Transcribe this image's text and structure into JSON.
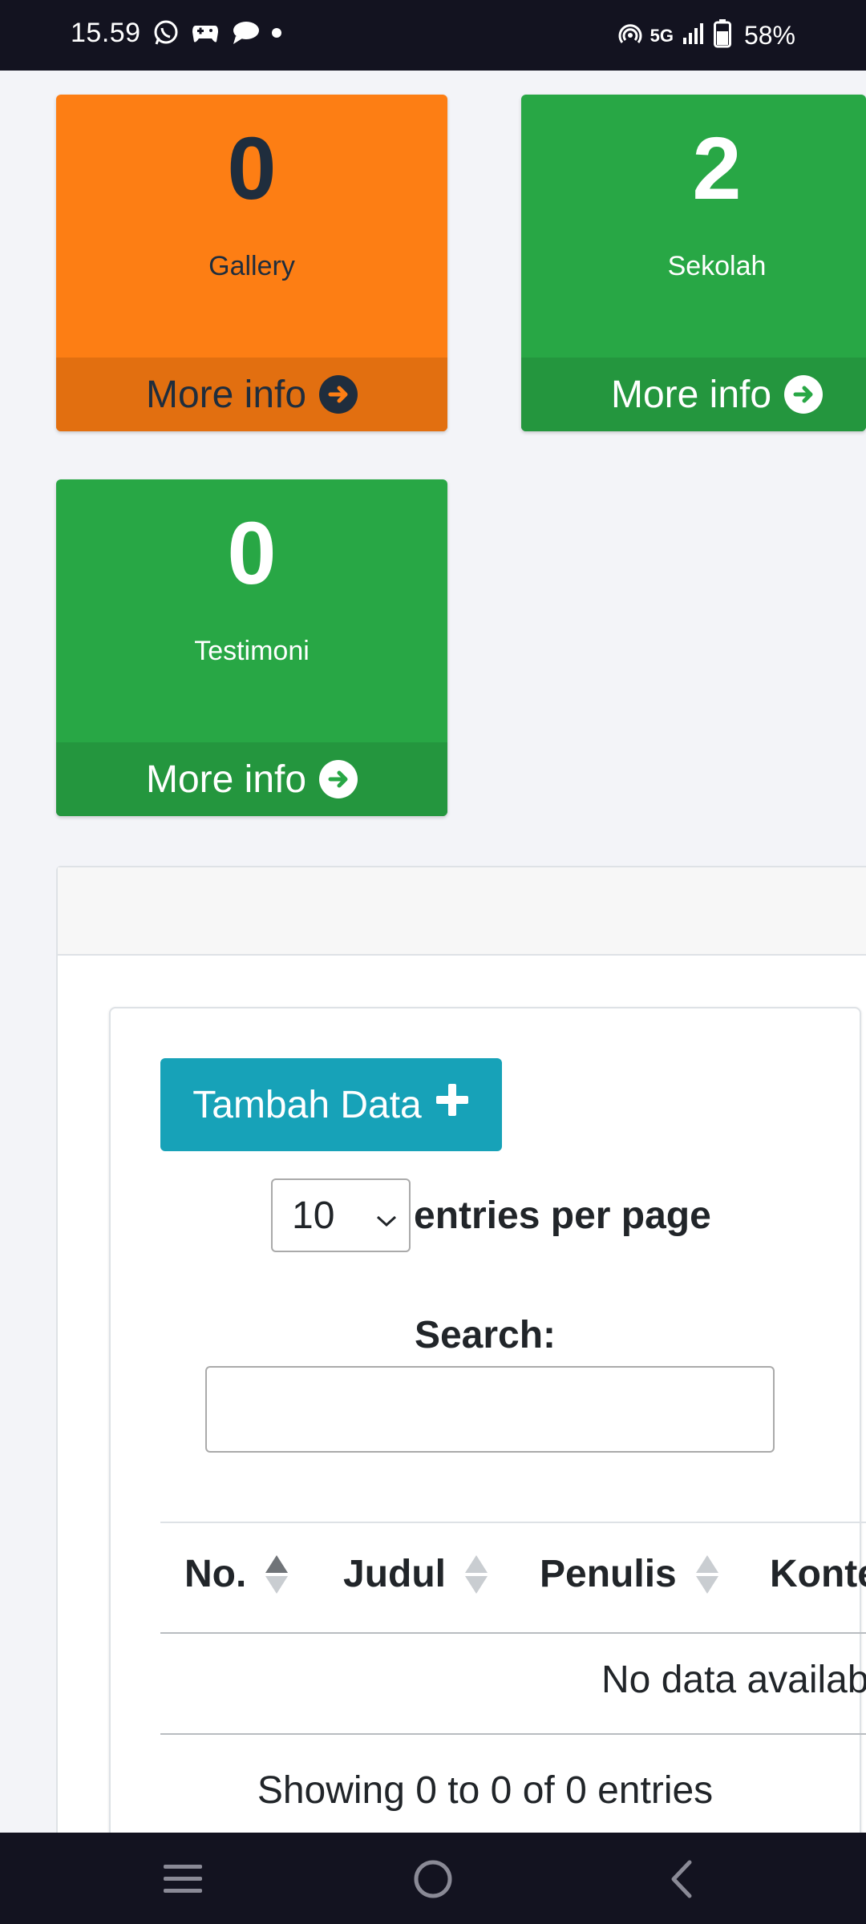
{
  "status_bar": {
    "time": "15.59",
    "network": "5G",
    "battery": "58%",
    "icons": [
      "whatsapp-icon",
      "gamepad-icon",
      "message-icon",
      "dot-icon",
      "hotspot-icon",
      "signal-icon",
      "battery-icon"
    ]
  },
  "boxes": [
    {
      "count": "0",
      "label": "Gallery",
      "more": "More info",
      "color": "#fd7e14"
    },
    {
      "count": "2",
      "label": "Sekolah",
      "more": "More info",
      "color": "#28a745"
    },
    {
      "count": "0",
      "label": "Testimoni",
      "more": "More info",
      "color": "#28a745"
    }
  ],
  "table": {
    "add_button": "Tambah Data",
    "page_size": "10",
    "entries_label": "entries per page",
    "search_label": "Search:",
    "search_value": "",
    "columns": [
      "No.",
      "Judul",
      "Penulis",
      "Konte"
    ],
    "empty_message": "No data available",
    "info": "Showing 0 to 0 of 0 entries"
  },
  "nav": {
    "icons": [
      "menu-icon",
      "home-icon",
      "back-icon"
    ]
  },
  "colors": {
    "info": "#17a2b8",
    "warning": "#fd7e14",
    "success": "#28a745",
    "status_bar": "#131320"
  }
}
